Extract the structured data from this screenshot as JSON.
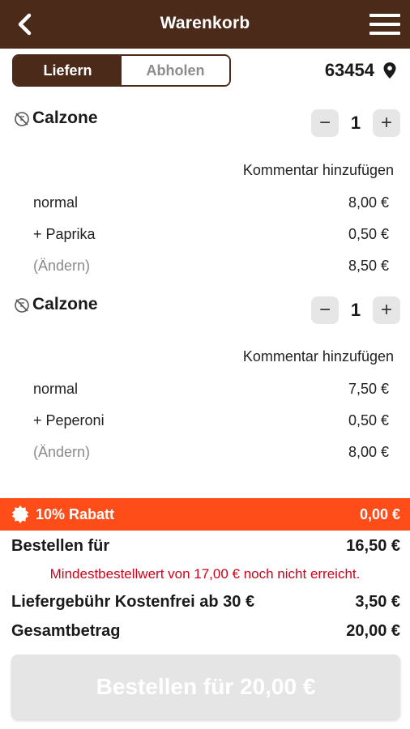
{
  "header": {
    "title": "Warenkorb"
  },
  "delivery_toggle": {
    "deliver_label": "Liefern",
    "pickup_label": "Abholen"
  },
  "location": {
    "zip": "63454"
  },
  "items": [
    {
      "name": "Calzone",
      "quantity": "1",
      "comment_label": "Kommentar hinzufügen",
      "lines": [
        {
          "label": "normal",
          "price": "8,00 €"
        },
        {
          "label": "+ Paprika",
          "price": "0,50 €"
        },
        {
          "label": "(Ändern)",
          "price": "8,50 €"
        }
      ]
    },
    {
      "name": "Calzone",
      "quantity": "1",
      "comment_label": "Kommentar hinzufügen",
      "lines": [
        {
          "label": "normal",
          "price": "7,50 €"
        },
        {
          "label": "+ Peperoni",
          "price": "0,50 €"
        },
        {
          "label": "(Ändern)",
          "price": "8,00 €"
        }
      ]
    }
  ],
  "stepper": {
    "minus": "−",
    "plus": "+"
  },
  "discount": {
    "label": "10% Rabatt",
    "value": "0,00 €",
    "color": "#ff4d1a"
  },
  "summary": {
    "order_for_label": "Bestellen für",
    "order_for_value": "16,50 €",
    "min_order_warning": "Mindestbestellwert von 17,00 € noch nicht erreicht.",
    "delivery_fee_label": "Liefergebühr Kostenfrei ab 30 €",
    "delivery_fee_value": "3,50 €",
    "total_label": "Gesamtbetrag",
    "total_value": "20,00 €"
  },
  "order_button": {
    "label": "Bestellen für 20,00 €",
    "enabled": false
  },
  "colors": {
    "brand": "#4b2a1a",
    "warning": "#d0021b",
    "disabled_button": "#e5e5e5"
  },
  "icons": {
    "back": "chevron-left-icon",
    "menu": "hamburger-menu-icon",
    "location": "map-pin-icon",
    "item": "no-symbol-icon",
    "discount": "badge-icon"
  }
}
